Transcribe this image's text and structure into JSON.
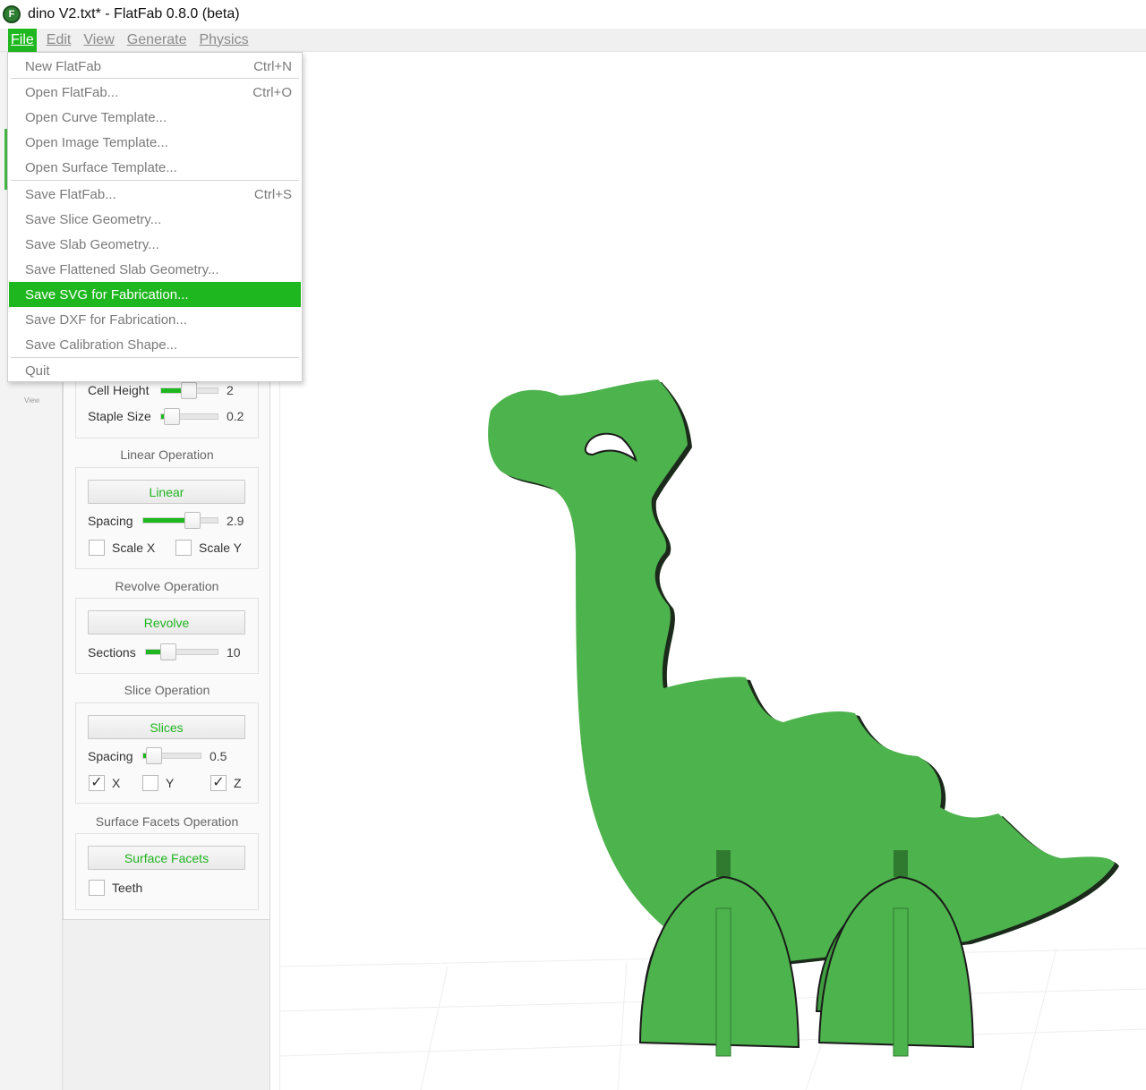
{
  "window": {
    "title": "dino V2.txt* - FlatFab 0.8.0 (beta)",
    "icon": "flatfab-app-icon"
  },
  "menubar": {
    "items": [
      {
        "label": "File",
        "active": true
      },
      {
        "label": "Edit"
      },
      {
        "label": "View"
      },
      {
        "label": "Generate"
      },
      {
        "label": "Physics"
      }
    ]
  },
  "file_menu": {
    "items": [
      {
        "label": "New FlatFab",
        "shortcut": "Ctrl+N"
      },
      {
        "label": "Open FlatFab...",
        "shortcut": "Ctrl+O"
      },
      {
        "label": "Open Curve Template...",
        "shortcut": ""
      },
      {
        "label": "Open Image Template...",
        "shortcut": ""
      },
      {
        "label": "Open Surface Template...",
        "shortcut": ""
      },
      {
        "label": "Save FlatFab...",
        "shortcut": "Ctrl+S"
      },
      {
        "label": "Save Slice Geometry...",
        "shortcut": ""
      },
      {
        "label": "Save Slab Geometry...",
        "shortcut": ""
      },
      {
        "label": "Save Flattened Slab Geometry...",
        "shortcut": ""
      },
      {
        "label": "Save SVG for Fabrication...",
        "shortcut": "",
        "highlighted": true
      },
      {
        "label": "Save DXF for Fabrication...",
        "shortcut": ""
      },
      {
        "label": "Save Calibration Shape...",
        "shortcut": ""
      },
      {
        "label": "Quit",
        "shortcut": ""
      }
    ]
  },
  "left_strip": {
    "view_label": "View"
  },
  "panel": {
    "cell_height": {
      "label": "Cell Height",
      "value": "2",
      "level": 0.35
    },
    "staple_size": {
      "label": "Staple Size",
      "value": "0.2",
      "level": 0.05
    },
    "linear": {
      "title": "Linear Operation",
      "button": "Linear",
      "spacing_label": "Spacing",
      "spacing_value": "2.9",
      "spacing_level": 0.55,
      "scale_x": "Scale X",
      "scale_y": "Scale Y"
    },
    "revolve": {
      "title": "Revolve Operation",
      "button": "Revolve",
      "sections_label": "Sections",
      "sections_value": "10",
      "sections_level": 0.2
    },
    "slice": {
      "title": "Slice Operation",
      "button": "Slices",
      "spacing_label": "Spacing",
      "spacing_value": "0.5",
      "spacing_level": 0.05,
      "x_label": "X",
      "x_checked": true,
      "x_mark": "✓",
      "y_label": "Y",
      "y_checked": false,
      "z_label": "Z",
      "z_checked": true,
      "z_mark": "✓"
    },
    "surface_facets": {
      "title": "Surface Facets Operation",
      "button": "Surface Facets",
      "teeth_label": "Teeth"
    }
  },
  "colors": {
    "accent": "#1fb71f",
    "dino_fill": "#4db34d",
    "dino_outline": "#1a1a1a"
  }
}
